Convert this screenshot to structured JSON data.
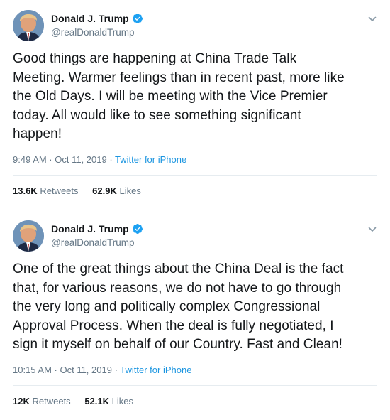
{
  "colors": {
    "text": "#14171a",
    "secondary": "#657786",
    "link": "#1b95e0",
    "verified": "#1da1f2",
    "divider": "#e6ecf0"
  },
  "tweets": [
    {
      "author": {
        "display_name": "Donald J. Trump",
        "handle": "@realDonaldTrump",
        "verified_icon": "verified-badge-icon",
        "avatar_icon": "profile-avatar"
      },
      "menu_icon": "chevron-down-icon",
      "text": "Good things are happening at China Trade Talk\nMeeting. Warmer feelings than in recent past, more like\nthe Old Days. I will be meeting with the Vice Premier\ntoday. All would like to see something significant\nhappen!",
      "timestamp": "9:49 AM · Oct 11, 2019 · ",
      "source": "Twitter for iPhone",
      "retweets_count": "13.6K",
      "retweets_label": "Retweets",
      "likes_count": "62.9K",
      "likes_label": "Likes"
    },
    {
      "author": {
        "display_name": "Donald J. Trump",
        "handle": "@realDonaldTrump",
        "verified_icon": "verified-badge-icon",
        "avatar_icon": "profile-avatar"
      },
      "menu_icon": "chevron-down-icon",
      "text": "One of the great things about the China Deal is the fact\nthat, for various reasons, we do not have to go through\nthe very long and politically complex Congressional\nApproval Process. When the deal is fully negotiated, I\nsign it myself on behalf of our Country. Fast and Clean!",
      "timestamp": "10:15 AM · Oct 11, 2019 · ",
      "source": "Twitter for iPhone",
      "retweets_count": "12K",
      "retweets_label": "Retweets",
      "likes_count": "52.1K",
      "likes_label": "Likes"
    }
  ]
}
